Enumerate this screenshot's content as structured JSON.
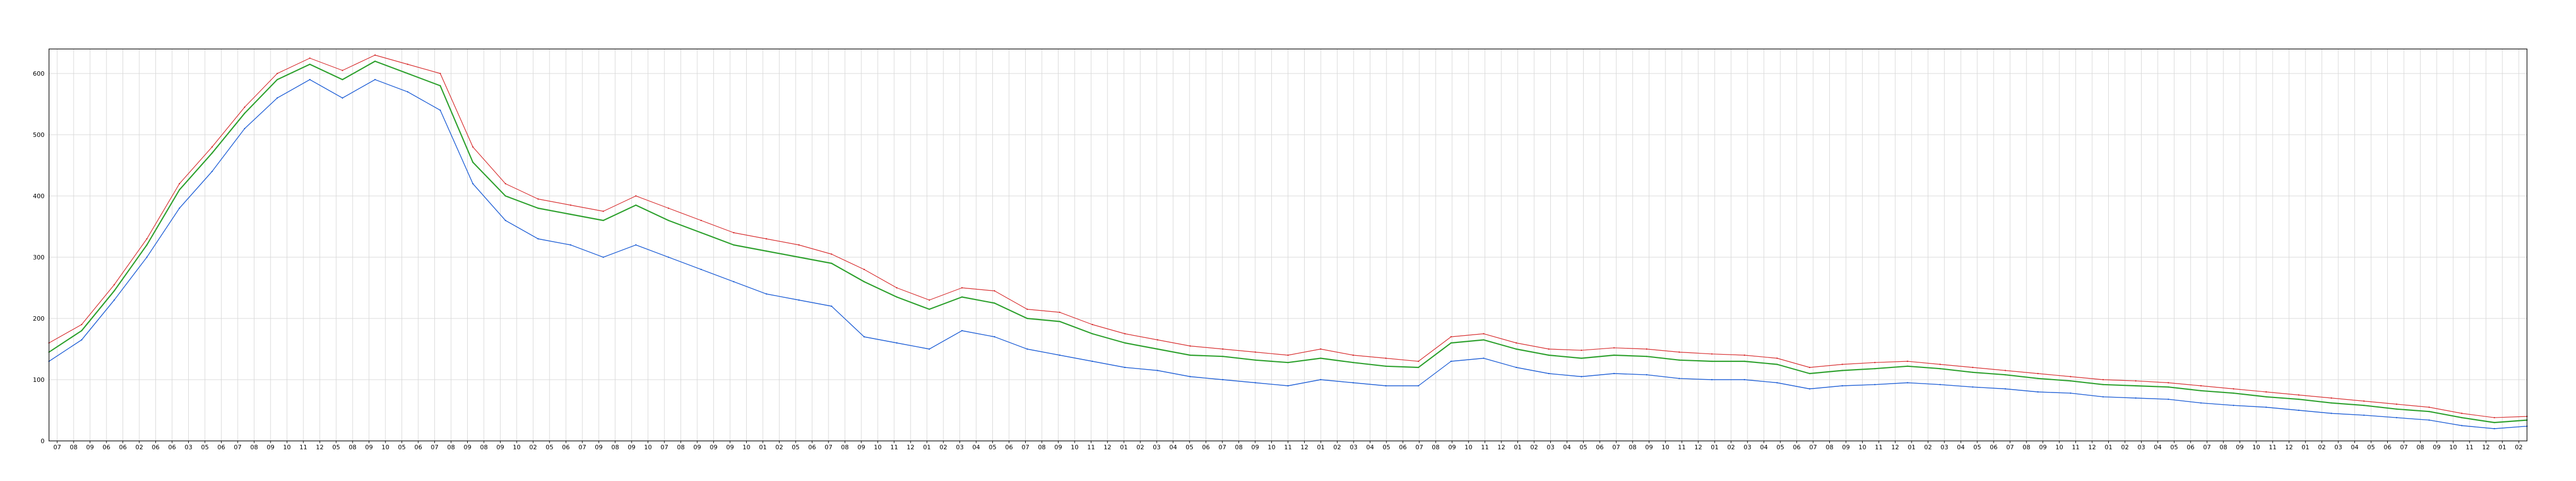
{
  "chart_data": {
    "type": "line",
    "title": "",
    "xlabel": "",
    "ylabel": "",
    "ylim": [
      0,
      640
    ],
    "yticks": [
      0,
      100,
      200,
      300,
      400,
      500,
      600
    ],
    "ytick_labels": [
      "0",
      "100",
      "200",
      "300",
      "400",
      "500",
      "600"
    ],
    "xlim": [
      0,
      152
    ],
    "grid": true,
    "legend": "none",
    "colors": {
      "high": "#d62728",
      "low": "#1f5fd6",
      "close": "#2ca02c",
      "frame": "#000000",
      "grid": "#d9d9d9"
    },
    "x_tick_labels": [
      "07",
      "08",
      "09",
      "06",
      "06",
      "02",
      "06",
      "06",
      "03",
      "05",
      "06",
      "07",
      "08",
      "09",
      "10",
      "11",
      "12",
      "05",
      "08",
      "09",
      "10",
      "05",
      "06",
      "07",
      "08",
      "09",
      "08",
      "09",
      "10",
      "02",
      "05",
      "06",
      "07",
      "09",
      "08",
      "09",
      "10",
      "07",
      "08",
      "09",
      "09",
      "09",
      "10",
      "01",
      "02",
      "05",
      "06",
      "07",
      "08",
      "09",
      "10",
      "11",
      "12",
      "01",
      "02",
      "03",
      "04",
      "05",
      "06",
      "07",
      "08",
      "09",
      "10",
      "11",
      "12",
      "01",
      "02",
      "03",
      "04",
      "05",
      "06",
      "07",
      "08",
      "09",
      "10",
      "11",
      "12",
      "01",
      "02",
      "03",
      "04",
      "05",
      "06",
      "07",
      "08",
      "09",
      "10",
      "11",
      "12",
      "01",
      "02",
      "03",
      "04",
      "05",
      "06",
      "07",
      "08",
      "09",
      "10",
      "11",
      "12",
      "01",
      "02",
      "03",
      "04",
      "05",
      "06",
      "07",
      "08",
      "09",
      "10",
      "11",
      "12",
      "01",
      "02",
      "03",
      "04",
      "05",
      "06",
      "07",
      "08",
      "09",
      "10",
      "11",
      "12",
      "01",
      "02",
      "03",
      "04",
      "05",
      "06",
      "07",
      "08",
      "09",
      "10",
      "11",
      "12",
      "01",
      "02",
      "03",
      "04",
      "05",
      "06",
      "07",
      "08",
      "09",
      "10",
      "11",
      "12",
      "01",
      "02"
    ],
    "x": [
      0,
      2,
      4,
      6,
      8,
      10,
      12,
      14,
      16,
      18,
      20,
      22,
      24,
      26,
      28,
      30,
      32,
      34,
      36,
      38,
      40,
      42,
      44,
      46,
      48,
      50,
      52,
      54,
      56,
      58,
      60,
      62,
      64,
      66,
      68,
      70,
      72,
      74,
      76,
      78,
      80,
      82,
      84,
      86,
      88,
      90,
      92,
      94,
      96,
      98,
      100,
      102,
      104,
      106,
      108,
      110,
      112,
      114,
      116,
      118,
      120,
      122,
      124,
      126,
      128,
      130,
      132,
      134,
      136,
      138,
      140,
      142,
      144,
      146,
      148,
      150,
      152
    ],
    "series": [
      {
        "key": "high",
        "values": [
          160,
          190,
          255,
          330,
          420,
          480,
          545,
          600,
          625,
          605,
          630,
          615,
          600,
          480,
          420,
          395,
          385,
          375,
          400,
          380,
          360,
          340,
          330,
          320,
          305,
          280,
          250,
          230,
          250,
          245,
          215,
          210,
          190,
          175,
          165,
          155,
          150,
          145,
          140,
          150,
          140,
          135,
          130,
          170,
          175,
          160,
          150,
          148,
          152,
          150,
          145,
          142,
          140,
          135,
          120,
          125,
          128,
          130,
          125,
          120,
          115,
          110,
          105,
          100,
          98,
          95,
          90,
          85,
          80,
          75,
          70,
          65,
          60,
          55,
          45,
          38,
          40
        ]
      },
      {
        "key": "close",
        "values": [
          145,
          180,
          245,
          320,
          410,
          470,
          535,
          590,
          615,
          590,
          620,
          600,
          580,
          455,
          400,
          380,
          370,
          360,
          385,
          360,
          340,
          320,
          310,
          300,
          290,
          260,
          235,
          215,
          235,
          225,
          200,
          195,
          175,
          160,
          150,
          140,
          138,
          132,
          128,
          135,
          128,
          122,
          120,
          160,
          165,
          150,
          140,
          135,
          140,
          138,
          132,
          130,
          130,
          125,
          110,
          115,
          118,
          122,
          118,
          112,
          108,
          102,
          98,
          92,
          90,
          88,
          82,
          78,
          72,
          68,
          62,
          58,
          52,
          48,
          38,
          30,
          34
        ]
      },
      {
        "key": "low",
        "values": [
          130,
          165,
          230,
          300,
          380,
          440,
          510,
          560,
          590,
          560,
          590,
          570,
          540,
          420,
          360,
          330,
          320,
          300,
          320,
          300,
          280,
          260,
          240,
          230,
          220,
          170,
          160,
          150,
          180,
          170,
          150,
          140,
          130,
          120,
          115,
          105,
          100,
          95,
          90,
          100,
          95,
          90,
          90,
          130,
          135,
          120,
          110,
          105,
          110,
          108,
          102,
          100,
          100,
          95,
          85,
          90,
          92,
          95,
          92,
          88,
          85,
          80,
          78,
          72,
          70,
          68,
          62,
          58,
          55,
          50,
          45,
          42,
          38,
          34,
          25,
          20,
          24
        ]
      }
    ]
  }
}
